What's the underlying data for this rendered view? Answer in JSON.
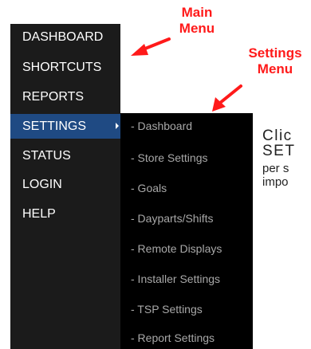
{
  "main_menu": {
    "items": [
      {
        "label": "DASHBOARD"
      },
      {
        "label": "SHORTCUTS"
      },
      {
        "label": "REPORTS"
      },
      {
        "label": "SETTINGS",
        "active": true
      },
      {
        "label": "STATUS"
      },
      {
        "label": "LOGIN"
      },
      {
        "label": "HELP"
      }
    ]
  },
  "settings_menu": {
    "items": [
      {
        "label": "- Dashboard"
      },
      {
        "label": "- Store Settings"
      },
      {
        "label": "- Goals"
      },
      {
        "label": "- Dayparts/Shifts"
      },
      {
        "label": "- Remote Displays"
      },
      {
        "label": "- Installer Settings"
      },
      {
        "label": "- TSP Settings"
      },
      {
        "label": "- Report Settings"
      }
    ]
  },
  "annotations": {
    "main_menu_label": {
      "line1": "Main",
      "line2": "Menu"
    },
    "settings_menu_label": {
      "line1": "Settings",
      "line2": "Menu"
    }
  },
  "instructions": {
    "line1": "Clic",
    "line2": "SET",
    "line3": "per s",
    "line4": "impo"
  },
  "colors": {
    "main_menu_bg": "#1b1b1b",
    "active_item_bg": "#1f4a83",
    "submenu_bg": "#000000",
    "submenu_text": "#a8a8a8",
    "annotation_red": "#ff1a1a"
  }
}
